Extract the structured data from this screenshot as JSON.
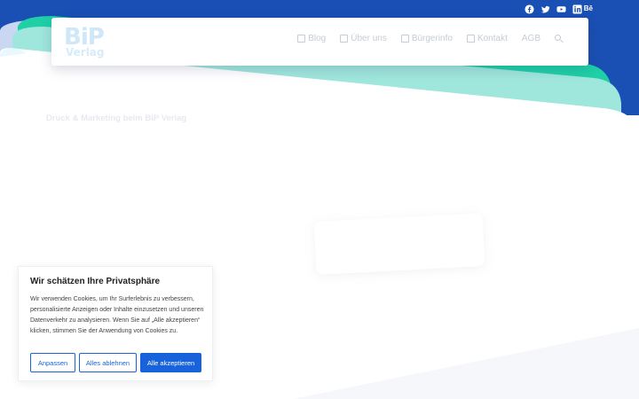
{
  "social": [
    {
      "icon": "facebook-icon"
    },
    {
      "icon": "twitter-icon"
    },
    {
      "icon": "youtube-icon"
    },
    {
      "icon": "linkedin-icon"
    },
    {
      "icon": "behance-icon",
      "label": "Bē"
    }
  ],
  "logo": {
    "big": "BiP",
    "small": "Verlag"
  },
  "nav": [
    {
      "label": "Blog",
      "icon": "blog-icon"
    },
    {
      "label": "Über uns",
      "icon": "about-icon"
    },
    {
      "label": "Bürgerinfo",
      "icon": "info-icon"
    },
    {
      "label": "Kontakt",
      "icon": "contact-icon"
    },
    {
      "label": "AGB"
    }
  ],
  "tagline": "Druck & Marketing beim BiP Verlag",
  "cookie": {
    "title": "Wir schätzen Ihre Privatsphäre",
    "text": "Wir verwenden Cookies, um Ihr Surferlebnis zu verbessern, personalisierte Anzeigen oder Inhalte einzusetzen und unseren Datenverkehr zu analysieren. Wenn Sie auf „Alle akzeptieren“ klicken, stimmen Sie der Anwendung von Cookies zu.",
    "customize": "Anpassen",
    "reject": "Alles ablehnen",
    "accept": "Alle akzeptieren"
  },
  "colors": {
    "brand_blue": "#1a4fb4",
    "teal": "#1fcfa6",
    "mint": "#9fe6dc",
    "button_blue": "#1863dc"
  }
}
